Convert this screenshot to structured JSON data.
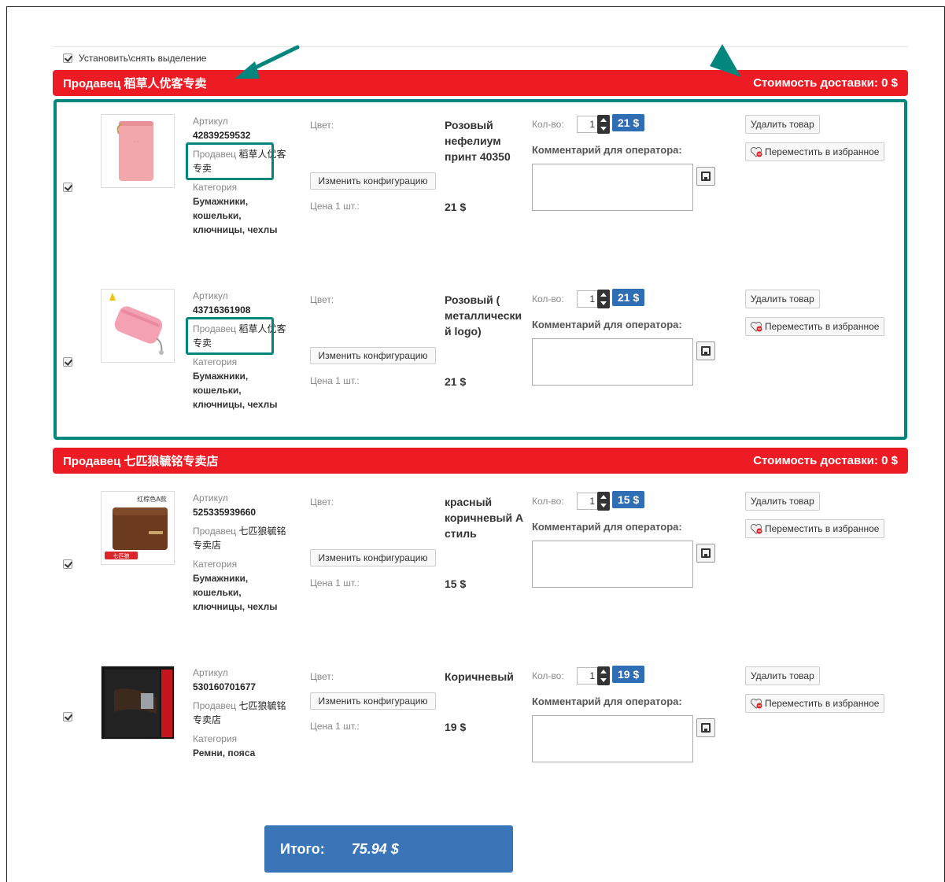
{
  "select_all_label": "Установить\\снять выделение",
  "shipping_label": "Стоимость доставки: 0 $",
  "sellers": [
    {
      "title": "Продавец 稻草人优客专卖",
      "items": [
        {
          "article_label": "Артикул",
          "article": "42839259532",
          "seller_label": "Продавец",
          "seller_name": "稻草人优客专卖",
          "category_label": "Категория",
          "category": "Бумажники, кошельки, ключницы, чехлы",
          "color_label": "Цвет:",
          "color_value": "Розовый нефелиум принт 40350",
          "config_button": "Изменить конфигурацию",
          "price_label": "Цена 1 шт.:",
          "price": "21 $",
          "qty_label": "Кол-во:",
          "qty": "1",
          "line_total": "21 $",
          "comment_label": "Комментарий для оператора:",
          "delete_button": "Удалить товар",
          "favorite_button": "Переместить в избранное"
        },
        {
          "article_label": "Артикул",
          "article": "43716361908",
          "seller_label": "Продавец",
          "seller_name": "稻草人优客专卖",
          "category_label": "Категория",
          "category": "Бумажники, кошельки, ключницы, чехлы",
          "color_label": "Цвет:",
          "color_value": "Розовый ( металлически й logo)",
          "config_button": "Изменить конфигурацию",
          "price_label": "Цена 1 шт.:",
          "price": "21 $",
          "qty_label": "Кол-во:",
          "qty": "1",
          "line_total": "21 $",
          "comment_label": "Комментарий для оператора:",
          "delete_button": "Удалить товар",
          "favorite_button": "Переместить в избранное"
        }
      ]
    },
    {
      "title": "Продавец 七匹狼毓铭专卖店",
      "items": [
        {
          "article_label": "Артикул",
          "article": "525335939660",
          "seller_label": "Продавец",
          "seller_name": "七匹狼毓铭专卖店",
          "category_label": "Категория",
          "category": "Бумажники, кошельки, ключницы, чехлы",
          "color_label": "Цвет:",
          "color_value": "красный коричневый А стиль",
          "config_button": "Изменить конфигурацию",
          "price_label": "Цена 1 шт.:",
          "price": "15 $",
          "qty_label": "Кол-во:",
          "qty": "1",
          "line_total": "15 $",
          "comment_label": "Комментарий для оператора:",
          "delete_button": "Удалить товар",
          "favorite_button": "Переместить в избранное",
          "thumb_caption": "红棕色A款",
          "thumb_badge": "七匹狼"
        },
        {
          "article_label": "Артикул",
          "article": "530160701677",
          "seller_label": "Продавец",
          "seller_name": "七匹狼毓铭专卖店",
          "category_label": "Категория",
          "category": "Ремни, пояса",
          "color_label": "Цвет:",
          "color_value": "Коричневый",
          "config_button": "Изменить конфигурацию",
          "price_label": "Цена 1 шт.:",
          "price": "19 $",
          "qty_label": "Кол-во:",
          "qty": "1",
          "line_total": "19 $",
          "comment_label": "Комментарий для оператора:",
          "delete_button": "Удалить товар",
          "favorite_button": "Переместить в избранное"
        }
      ]
    }
  ],
  "total": {
    "label": "Итого:",
    "amount": "75.94 $"
  },
  "colors": {
    "seller_bar": "#ed1c24",
    "highlight": "#00867d",
    "price_badge": "#2f6db5",
    "total_bg": "#3a75b8"
  },
  "icons": {
    "save": "save-icon",
    "favorite": "heart-icon",
    "spinner": "spinner-icon"
  }
}
